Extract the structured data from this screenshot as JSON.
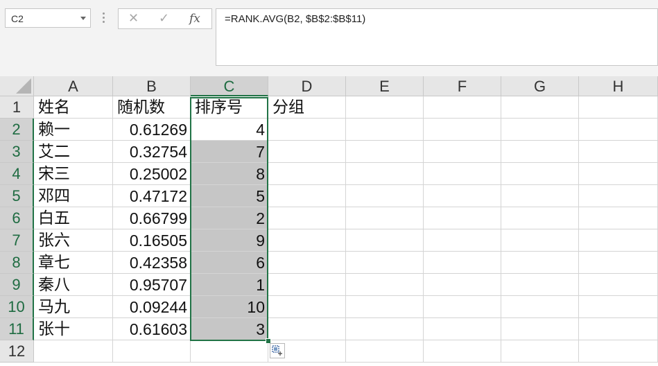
{
  "formula_bar": {
    "name_box": "C2",
    "formula": "=RANK.AVG(B2, $B$2:$B$11)",
    "cancel_icon": "✕",
    "enter_icon": "✓",
    "fx_label": "fx"
  },
  "columns": [
    "A",
    "B",
    "C",
    "D",
    "E",
    "F",
    "G",
    "H"
  ],
  "rows": [
    "1",
    "2",
    "3",
    "4",
    "5",
    "6",
    "7",
    "8",
    "9",
    "10",
    "11",
    "12"
  ],
  "headers": {
    "a": "姓名",
    "b": "随机数",
    "c": "排序号",
    "d": "分组"
  },
  "data": [
    {
      "name": "赖一",
      "rand": "0.61269",
      "rank": "4"
    },
    {
      "name": "艾二",
      "rand": "0.32754",
      "rank": "7"
    },
    {
      "name": "宋三",
      "rand": "0.25002",
      "rank": "8"
    },
    {
      "name": "邓四",
      "rand": "0.47172",
      "rank": "5"
    },
    {
      "name": "白五",
      "rand": "0.66799",
      "rank": "2"
    },
    {
      "name": "张六",
      "rand": "0.16505",
      "rank": "9"
    },
    {
      "name": "章七",
      "rand": "0.42358",
      "rank": "6"
    },
    {
      "name": "秦八",
      "rand": "0.95707",
      "rank": "1"
    },
    {
      "name": "马九",
      "rand": "0.09244",
      "rank": "10"
    },
    {
      "name": "张十",
      "rand": "0.61603",
      "rank": "3"
    }
  ],
  "colors": {
    "accent": "#217346",
    "selection_fill": "#c6c6c6",
    "header_bg": "#e6e6e6"
  }
}
